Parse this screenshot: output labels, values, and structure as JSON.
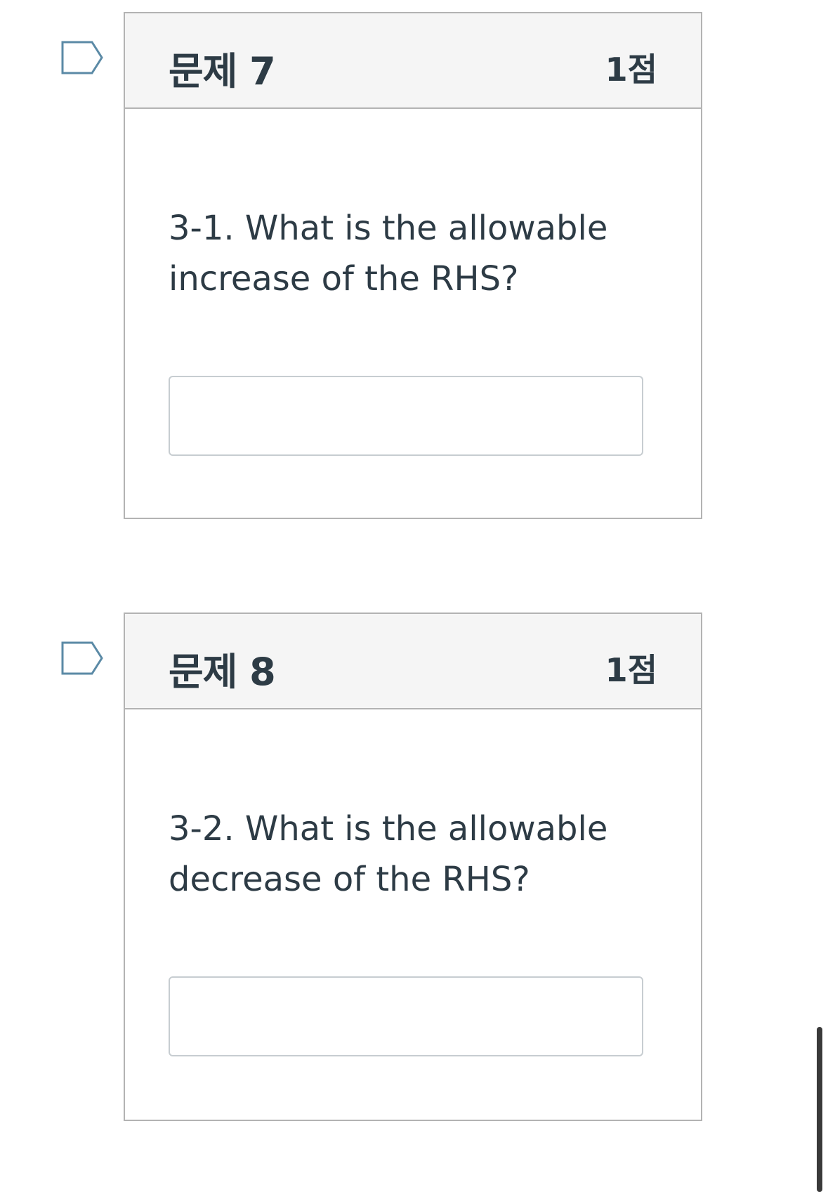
{
  "questions": [
    {
      "title": "문제 7",
      "points": "1점",
      "text": "3-1. What is the allowable increase of the RHS?",
      "answer_value": "",
      "flag_icon": "flag-outline-icon"
    },
    {
      "title": "문제 8",
      "points": "1점",
      "text": "3-2. What is the allowable decrease of the RHS?",
      "answer_value": "",
      "flag_icon": "flag-outline-icon"
    }
  ],
  "colors": {
    "text": "#2d3b45",
    "header_bg": "#f5f5f5",
    "border": "#b3b3b3",
    "flag": "#5b8aa6"
  }
}
